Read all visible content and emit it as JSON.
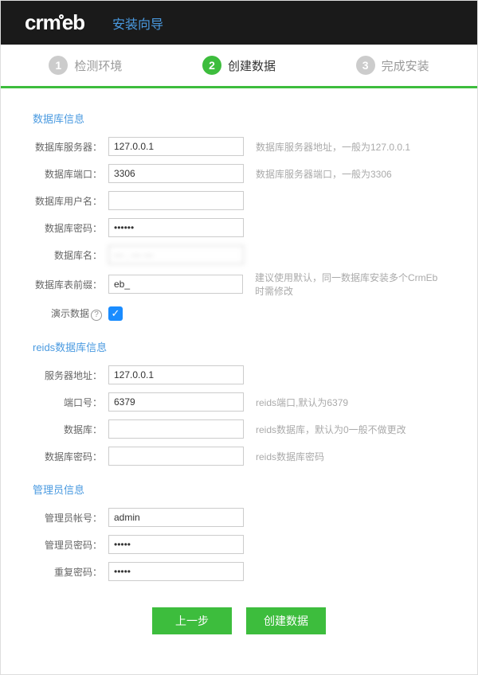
{
  "header": {
    "logo": "crmeb",
    "title": "安装向导"
  },
  "steps": [
    {
      "num": "1",
      "label": "检测环境",
      "active": false
    },
    {
      "num": "2",
      "label": "创建数据",
      "active": true
    },
    {
      "num": "3",
      "label": "完成安装",
      "active": false
    }
  ],
  "sections": {
    "db": {
      "title": "数据库信息",
      "fields": {
        "host": {
          "label": "数据库服务器：",
          "value": "127.0.0.1",
          "hint": "数据库服务器地址，一般为127.0.0.1"
        },
        "port": {
          "label": "数据库端口：",
          "value": "3306",
          "hint": "数据库服务器端口，一般为3306"
        },
        "user": {
          "label": "数据库用户名：",
          "value": "",
          "hint": ""
        },
        "pass": {
          "label": "数据库密码：",
          "value": "••••••",
          "hint": ""
        },
        "name": {
          "label": "数据库名：",
          "value": "",
          "hint": ""
        },
        "prefix": {
          "label": "数据库表前缀：",
          "value": "eb_",
          "hint": "建议使用默认，同一数据库安装多个CrmEb时需修改"
        },
        "demo": {
          "label": "演示数据",
          "checked": true
        }
      }
    },
    "redis": {
      "title": "reids数据库信息",
      "fields": {
        "host": {
          "label": "服务器地址：",
          "value": "127.0.0.1",
          "hint": ""
        },
        "port": {
          "label": "端口号：",
          "value": "6379",
          "hint": "reids端口,默认为6379"
        },
        "db": {
          "label": "数据库：",
          "value": "",
          "hint": "reids数据库，默认为0一般不做更改"
        },
        "pass": {
          "label": "数据库密码：",
          "value": "",
          "hint": "reids数据库密码"
        }
      }
    },
    "admin": {
      "title": "管理员信息",
      "fields": {
        "user": {
          "label": "管理员帐号：",
          "value": "admin"
        },
        "pass": {
          "label": "管理员密码：",
          "value": "•••••"
        },
        "pass2": {
          "label": "重复密码：",
          "value": "•••••"
        }
      }
    }
  },
  "buttons": {
    "prev": "上一步",
    "next": "创建数据"
  }
}
